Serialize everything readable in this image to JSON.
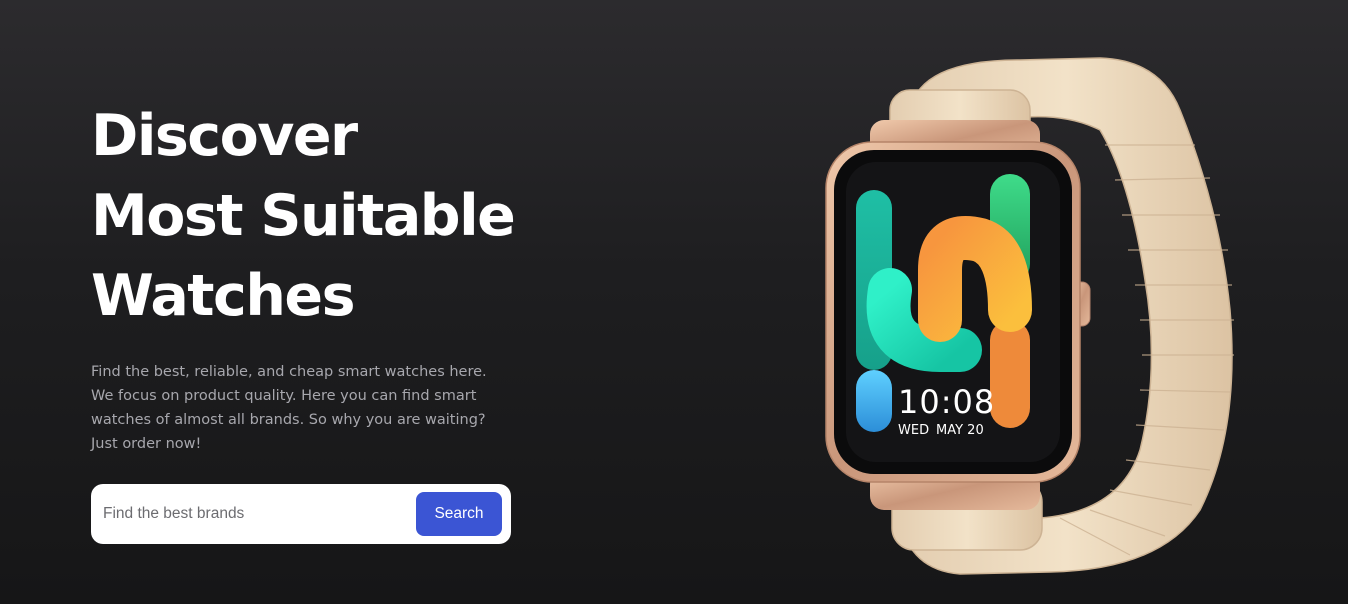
{
  "hero": {
    "title_lines": [
      "Discover",
      "Most Suitable",
      "Watches"
    ],
    "description": "Find the best, reliable, and cheap smart watches here. We focus on product quality. Here you can find smart watches of almost all brands. So why you are waiting? Just order now!"
  },
  "search": {
    "placeholder": "Find the best brands",
    "value": "",
    "button_label": "Search"
  },
  "watch": {
    "time": "10:08",
    "day": "WED",
    "date": "MAY 20",
    "band_color": "#efdcc0",
    "case_color": "#d7a98a"
  },
  "colors": {
    "accent": "#3b55d4",
    "title": "#ffffff",
    "description": "#a7a7ad"
  }
}
